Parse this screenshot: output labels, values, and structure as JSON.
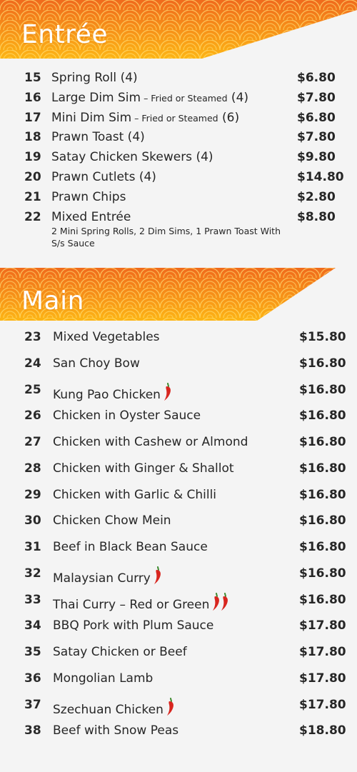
{
  "sections": {
    "entree": {
      "title": "Entrée",
      "items": [
        {
          "num": "15",
          "name": "Spring Roll (4)",
          "price": "$6.80"
        },
        {
          "num": "16",
          "name": "Large Dim Sim",
          "sub": " – Fried or Steamed",
          "suffix": " (4)",
          "price": "$7.80"
        },
        {
          "num": "17",
          "name": "Mini Dim Sim",
          "sub": " – Fried or Steamed",
          "suffix": " (6)",
          "price": "$6.80"
        },
        {
          "num": "18",
          "name": "Prawn Toast (4)",
          "price": "$7.80"
        },
        {
          "num": "19",
          "name": "Satay Chicken Skewers (4)",
          "price": "$9.80"
        },
        {
          "num": "20",
          "name": "Prawn Cutlets (4)",
          "price": "$14.80"
        },
        {
          "num": "21",
          "name": "Prawn Chips",
          "price": "$2.80"
        },
        {
          "num": "22",
          "name": "Mixed Entrée",
          "desc": "2 Mini Spring Rolls, 2 Dim Sims, 1 Prawn Toast With S/s Sauce",
          "price": "$8.80"
        }
      ]
    },
    "main": {
      "title": "Main",
      "items": [
        {
          "num": "23",
          "name": "Mixed Vegetables",
          "price": "$15.80",
          "chillies": 0
        },
        {
          "num": "24",
          "name": "San Choy Bow",
          "price": "$16.80",
          "chillies": 0
        },
        {
          "num": "25",
          "name": "Kung Pao Chicken",
          "price": "$16.80",
          "chillies": 1
        },
        {
          "num": "26",
          "name": "Chicken in Oyster Sauce",
          "price": "$16.80",
          "chillies": 0
        },
        {
          "num": "27",
          "name": "Chicken with Cashew or Almond",
          "price": "$16.80",
          "chillies": 0
        },
        {
          "num": "28",
          "name": "Chicken with Ginger & Shallot",
          "price": "$16.80",
          "chillies": 0
        },
        {
          "num": "29",
          "name": "Chicken with Garlic & Chilli",
          "price": "$16.80",
          "chillies": 0
        },
        {
          "num": "30",
          "name": "Chicken Chow Mein",
          "price": "$16.80",
          "chillies": 0
        },
        {
          "num": "31",
          "name": "Beef in Black Bean Sauce",
          "price": "$16.80",
          "chillies": 0
        },
        {
          "num": "32",
          "name": "Malaysian Curry",
          "price": "$16.80",
          "chillies": 1
        },
        {
          "num": "33",
          "name": "Thai Curry – Red or Green",
          "price": "$16.80",
          "chillies": 2
        },
        {
          "num": "34",
          "name": "BBQ Pork with Plum Sauce",
          "price": "$17.80",
          "chillies": 0
        },
        {
          "num": "35",
          "name": "Satay Chicken or Beef",
          "price": "$17.80",
          "chillies": 0
        },
        {
          "num": "36",
          "name": "Mongolian Lamb",
          "price": "$17.80",
          "chillies": 0
        },
        {
          "num": "37",
          "name": "Szechuan Chicken",
          "price": "$17.80",
          "chillies": 1
        },
        {
          "num": "38",
          "name": "Beef with Snow Peas",
          "price": "$18.80",
          "chillies": 0
        }
      ]
    }
  },
  "icons": {
    "spicy": "chilli-icon"
  },
  "colors": {
    "banner_orange": "#f27a1a",
    "banner_yellow": "#fdb515",
    "chilli_red": "#d8261f",
    "background": "#f4f4f4"
  }
}
